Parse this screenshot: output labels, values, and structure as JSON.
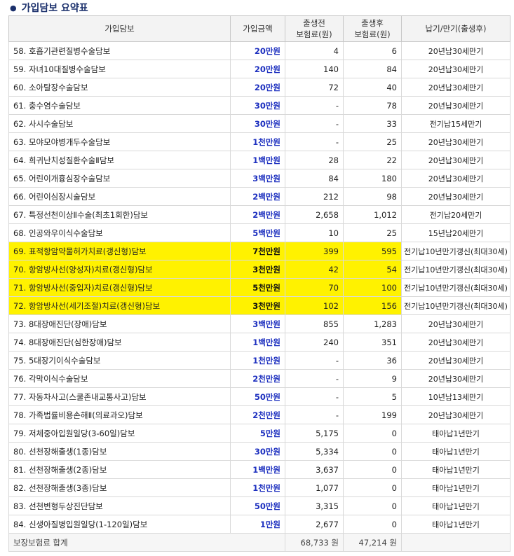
{
  "title": "가입담보 요약표",
  "headers": {
    "coverage": "가입담보",
    "amount": "가입금액",
    "pre_line1": "출생전",
    "pre_line2": "보험료(원)",
    "post_line1": "출생후",
    "post_line2": "보험료(원)",
    "term": "납기/만기(출생후)"
  },
  "rows": [
    {
      "name": "58. 호흡기관련질병수술담보",
      "amount": "20만원",
      "pre": "4",
      "post": "6",
      "term": "20년납30세만기",
      "hl": false
    },
    {
      "name": "59. 자녀10대질병수술담보",
      "amount": "20만원",
      "pre": "140",
      "post": "84",
      "term": "20년납30세만기",
      "hl": false
    },
    {
      "name": "60. 소아탈장수술담보",
      "amount": "20만원",
      "pre": "72",
      "post": "40",
      "term": "20년납30세만기",
      "hl": false
    },
    {
      "name": "61. 충수염수술담보",
      "amount": "30만원",
      "pre": "-",
      "post": "78",
      "term": "20년납30세만기",
      "hl": false
    },
    {
      "name": "62. 사시수술담보",
      "amount": "30만원",
      "pre": "-",
      "post": "33",
      "term": "전기납15세만기",
      "hl": false
    },
    {
      "name": "63. 모야모야병개두수술담보",
      "amount": "1천만원",
      "pre": "-",
      "post": "25",
      "term": "20년납30세만기",
      "hl": false
    },
    {
      "name": "64. 희귀난치성질환수술Ⅱ담보",
      "amount": "1백만원",
      "pre": "28",
      "post": "22",
      "term": "20년납30세만기",
      "hl": false
    },
    {
      "name": "65. 어린이개흉심장수술담보",
      "amount": "3백만원",
      "pre": "84",
      "post": "180",
      "term": "20년납30세만기",
      "hl": false
    },
    {
      "name": "66. 어린이심장시술담보",
      "amount": "2백만원",
      "pre": "212",
      "post": "98",
      "term": "20년납30세만기",
      "hl": false
    },
    {
      "name": "67. 특정선천이상Ⅱ수술(최초1회한)담보",
      "amount": "2백만원",
      "pre": "2,658",
      "post": "1,012",
      "term": "전기납20세만기",
      "hl": false
    },
    {
      "name": "68. 인공와우이식수술담보",
      "amount": "5백만원",
      "pre": "10",
      "post": "25",
      "term": "15년납20세만기",
      "hl": false
    },
    {
      "name": "69. 표적항암약물허가치료(갱신형)담보",
      "amount": "7천만원",
      "pre": "399",
      "post": "595",
      "term": "전기납10년만기갱신(최대30세)",
      "hl": true
    },
    {
      "name": "70. 항암방사선(양성자)치료(갱신형)담보",
      "amount": "3천만원",
      "pre": "42",
      "post": "54",
      "term": "전기납10년만기갱신(최대30세)",
      "hl": true
    },
    {
      "name": "71. 항암방사선(중입자)치료(갱신형)담보",
      "amount": "5천만원",
      "pre": "70",
      "post": "100",
      "term": "전기납10년만기갱신(최대30세)",
      "hl": true
    },
    {
      "name": "72. 항암방사선(세기조절)치료(갱신형)담보",
      "amount": "3천만원",
      "pre": "102",
      "post": "156",
      "term": "전기납10년만기갱신(최대30세)",
      "hl": true
    },
    {
      "name": "73. 8대장애진단(장애)담보",
      "amount": "3백만원",
      "pre": "855",
      "post": "1,283",
      "term": "20년납30세만기",
      "hl": false
    },
    {
      "name": "74. 8대장애진단(심한장애)담보",
      "amount": "1백만원",
      "pre": "240",
      "post": "351",
      "term": "20년납30세만기",
      "hl": false
    },
    {
      "name": "75. 5대장기이식수술담보",
      "amount": "1천만원",
      "pre": "-",
      "post": "36",
      "term": "20년납30세만기",
      "hl": false
    },
    {
      "name": "76. 각막이식수술담보",
      "amount": "2천만원",
      "pre": "-",
      "post": "9",
      "term": "20년납30세만기",
      "hl": false
    },
    {
      "name": "77. 자동차사고(스쿨존내교통사고)담보",
      "amount": "50만원",
      "pre": "-",
      "post": "5",
      "term": "10년납13세만기",
      "hl": false
    },
    {
      "name": "78. 가족법률비용손해Ⅱ(의료과오)담보",
      "amount": "2천만원",
      "pre": "-",
      "post": "199",
      "term": "20년납30세만기",
      "hl": false
    },
    {
      "name": "79. 저체중아입원일당(3-60일)담보",
      "amount": "5만원",
      "pre": "5,175",
      "post": "0",
      "term": "태아납1년만기",
      "hl": false
    },
    {
      "name": "80. 선천장해출생(1종)담보",
      "amount": "30만원",
      "pre": "5,334",
      "post": "0",
      "term": "태아납1년만기",
      "hl": false
    },
    {
      "name": "81. 선천장해출생(2종)담보",
      "amount": "1백만원",
      "pre": "3,637",
      "post": "0",
      "term": "태아납1년만기",
      "hl": false
    },
    {
      "name": "82. 선천장해출생(3종)담보",
      "amount": "1천만원",
      "pre": "1,077",
      "post": "0",
      "term": "태아납1년만기",
      "hl": false
    },
    {
      "name": "83. 선천변형두상진단담보",
      "amount": "50만원",
      "pre": "3,315",
      "post": "0",
      "term": "태아납1년만기",
      "hl": false
    },
    {
      "name": "84. 신생아질병입원일당(1-120일)담보",
      "amount": "1만원",
      "pre": "2,677",
      "post": "0",
      "term": "태아납1년만기",
      "hl": false
    }
  ],
  "total": {
    "label": "보장보험료 합계",
    "pre": "68,733 원",
    "post": "47,214 원"
  }
}
